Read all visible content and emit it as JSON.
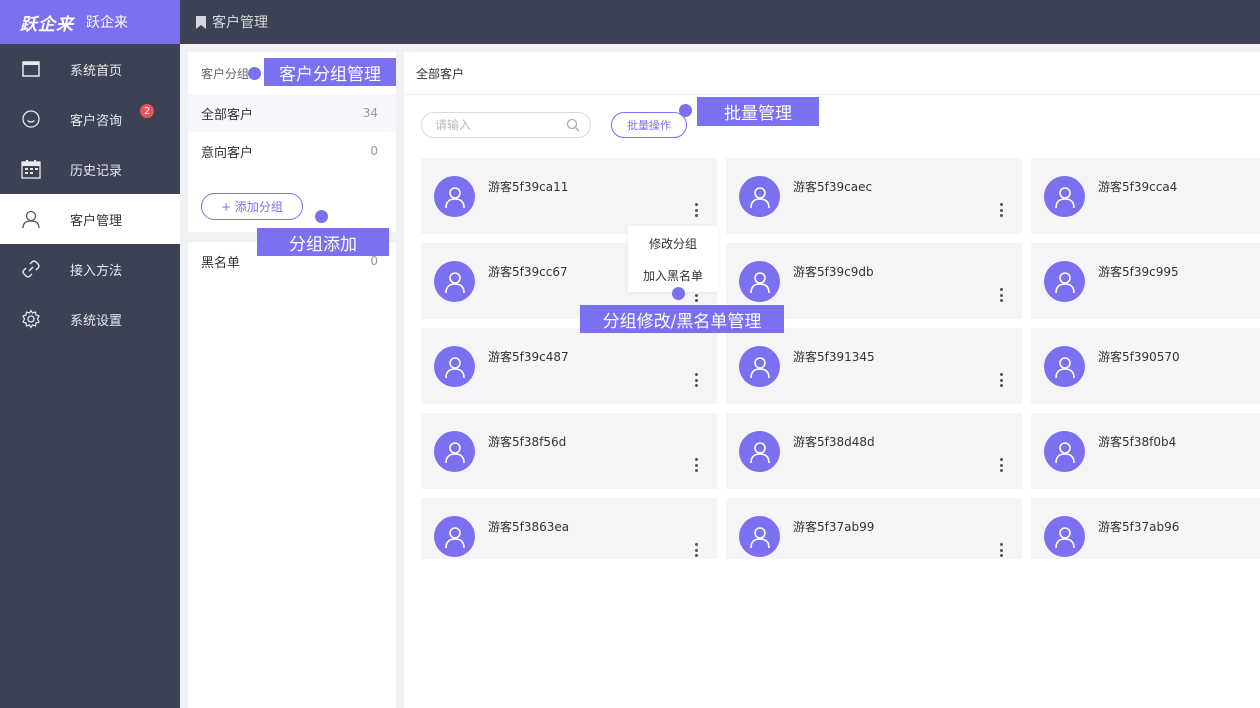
{
  "brand": {
    "logo_text": "跃企来",
    "name": "跃企来"
  },
  "header": {
    "page_title": "客户管理"
  },
  "sidebar": {
    "items": [
      {
        "label": "系统首页",
        "icon": "window-icon"
      },
      {
        "label": "客户咨询",
        "icon": "chat-icon",
        "badge": "2"
      },
      {
        "label": "历史记录",
        "icon": "calendar-icon"
      },
      {
        "label": "客户管理",
        "icon": "user-icon",
        "active": true
      },
      {
        "label": "接入方法",
        "icon": "link-icon"
      },
      {
        "label": "系统设置",
        "icon": "gear-icon"
      }
    ]
  },
  "groups": {
    "header": "客户分组",
    "items": [
      {
        "label": "全部客户",
        "count": "34"
      },
      {
        "label": "意向客户",
        "count": "0"
      }
    ],
    "add_button": "+ 添加分组",
    "blacklist": {
      "label": "黑名单",
      "count": "0"
    }
  },
  "main": {
    "header": "全部客户",
    "search_placeholder": "请输入",
    "batch_button": "批量操作",
    "customers": [
      "游客5f39ca11",
      "游客5f39caec",
      "游客5f39cca4",
      "游客5f39cc67",
      "游客5f39c9db",
      "游客5f39c995",
      "游客5f39c487",
      "游客5f391345",
      "游客5f390570",
      "游客5f38f56d",
      "游客5f38d48d",
      "游客5f38f0b4",
      "游客5f3863ea",
      "游客5f37ab99",
      "游客5f37ab96"
    ]
  },
  "context_menu": {
    "items": [
      "修改分组",
      "加入黑名单"
    ]
  },
  "callouts": {
    "group_manage": "客户分组管理",
    "batch_manage": "批量管理",
    "group_add": "分组添加",
    "modify_blacklist": "分组修改/黑名单管理"
  },
  "colors": {
    "accent": "#7b70f0",
    "dark": "#3c4253",
    "badge": "#f0505a"
  }
}
